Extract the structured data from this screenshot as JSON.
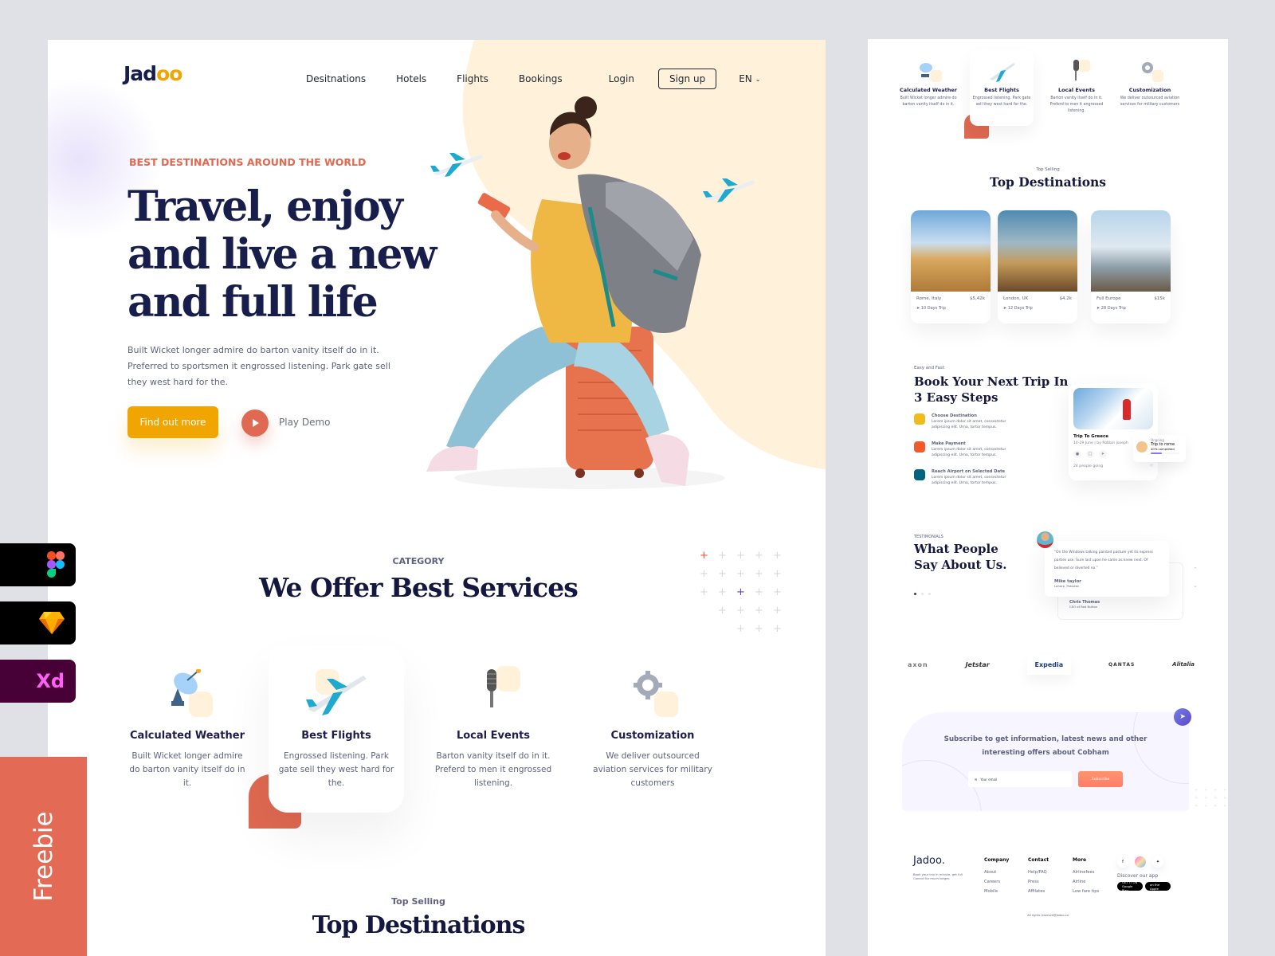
{
  "header": {
    "logo_text": "Jad",
    "logo_accent": "oo",
    "nav": [
      "Desitnations",
      "Hotels",
      "Flights",
      "Bookings"
    ],
    "login": "Login",
    "signup": "Sign up",
    "language": "EN"
  },
  "hero": {
    "kicker": "BEST DESTINATIONS AROUND THE WORLD",
    "title_line1": "Travel, enjoy",
    "title_line2": "and live a new",
    "title_line3": "and full life",
    "description": "Built Wicket longer admire do barton vanity itself do in it. Preferred to sportsmen it engrossed listening. Park gate sell they west hard for the.",
    "cta": "Find out more",
    "play_label": "Play Demo"
  },
  "category": {
    "kicker": "CATEGORY",
    "title": "We Offer Best Services",
    "services": [
      {
        "icon": "satellite-dish-icon",
        "title": "Calculated Weather",
        "text": "Built Wicket longer admire do barton vanity itself do in it."
      },
      {
        "icon": "airplane-icon",
        "title": "Best Flights",
        "text": "Engrossed listening. Park gate sell they west hard for the."
      },
      {
        "icon": "microphone-icon",
        "title": "Local Events",
        "text": "Barton vanity itself do in it. Preferd to men it engrossed listening."
      },
      {
        "icon": "gear-icon",
        "title": "Customization",
        "text": "We deliver outsourced aviation services for military customers"
      }
    ]
  },
  "top_selling": {
    "kicker": "Top Selling",
    "title": "Top Destinations",
    "destinations": [
      {
        "place": "Rome, Italy",
        "price": "$5,42k",
        "trip": "10 Days Trip"
      },
      {
        "place": "London, UK",
        "price": "$4.2k",
        "trip": "12 Days Trip"
      },
      {
        "place": "Full Europe",
        "price": "$15k",
        "trip": "28 Days Trip"
      }
    ]
  },
  "booking": {
    "kicker": "Easy and Fast",
    "title": "Book Your Next Trip In 3 Easy Steps",
    "steps": [
      {
        "title": "Choose Destination",
        "text": "Lorem ipsum dolor sit amet, consectetur adipiscing elit. Urna, tortor tempus.",
        "color": "#f0bb1f"
      },
      {
        "title": "Make Payment",
        "text": "Lorem ipsum dolor sit amet, consectetur adipiscing elit. Urna, tortor tempus.",
        "color": "#f15a2b"
      },
      {
        "title": "Reach Airport on Selected Date",
        "text": "Lorem ipsum dolor sit amet, consectetur adipiscing elit. Urna, tortor tempus.",
        "color": "#006380"
      }
    ],
    "trip_card": {
      "title": "Trip To Greece",
      "meta": "14-29 June | by Robbin joseph",
      "people": "24 people going"
    },
    "ongoing": {
      "label": "Ongoing",
      "title": "Trip to rome",
      "progress_text": "40% completed",
      "progress": 0.4
    }
  },
  "testimonials": {
    "kicker": "TESTIMONIALS",
    "title": "What People Say About Us.",
    "quote": "“On the Windows talking painted pasture yet its express parties use. Sure last upon he same as knew next. Of believed or diverted no.”",
    "name": "Mike taylor",
    "location": "Lahore, Pakistan",
    "back_name": "Chris Thomas",
    "back_role": "CEO of Red Button"
  },
  "partners": [
    "axon",
    "Jetstar",
    "Expedia",
    "QANTAS",
    "Alitalia"
  ],
  "subscribe": {
    "text": "Subscribe to get information, latest news and other interesting offers about Cobham",
    "placeholder": "Your email",
    "button": "Subscribe"
  },
  "footer": {
    "logo": "Jadoo.",
    "desc": "Book your trip in minute, get full Control for much longer.",
    "columns": [
      {
        "title": "Company",
        "links": [
          "About",
          "Careers",
          "Mobile"
        ]
      },
      {
        "title": "Contact",
        "links": [
          "Help/FAQ",
          "Press",
          "Affilates"
        ]
      },
      {
        "title": "More",
        "links": [
          "Airlinefees",
          "Airline",
          "Low fare tips"
        ]
      }
    ],
    "discover": "Discover our app",
    "stores": [
      "GET IT ON Google Play",
      "Available on the Apple Store"
    ],
    "copyright": "All rights reserved@jadoo.co"
  },
  "badges": {
    "xd": "Xd",
    "freebie": "Freebie"
  },
  "colors": {
    "accent": "#df6951",
    "yellow": "#f1a501",
    "navy": "#181e4b",
    "cream": "#fff1da"
  }
}
